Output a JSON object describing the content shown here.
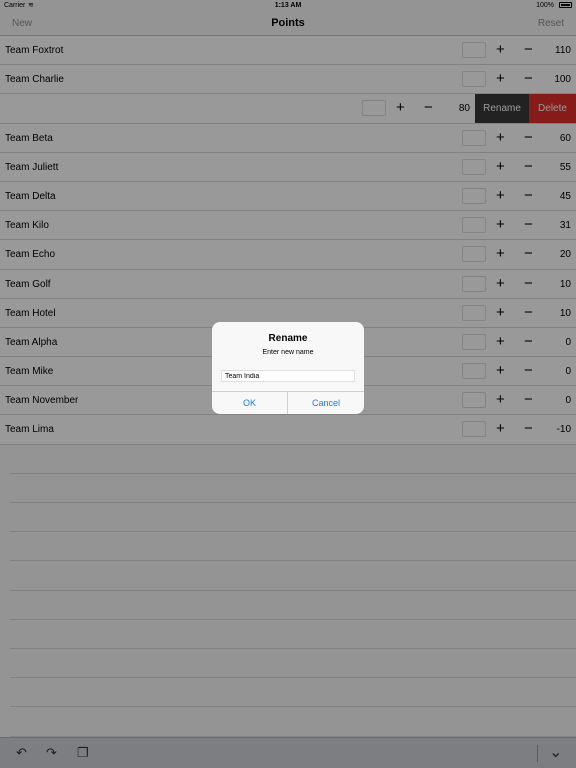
{
  "status_bar": {
    "carrier": "Carrier",
    "wifi_icon": "wifi-icon",
    "time": "1:13 AM",
    "battery": "100%"
  },
  "nav": {
    "left": "New",
    "title": "Points",
    "right": "Reset"
  },
  "rows": [
    {
      "name": "Team Foxtrot",
      "score": "110"
    },
    {
      "name": "Team Charlie",
      "score": "100"
    },
    {
      "name": "",
      "score": "80",
      "swiped": true
    },
    {
      "name": "Team Beta",
      "score": "60"
    },
    {
      "name": "Team Juliett",
      "score": "55"
    },
    {
      "name": "Team Delta",
      "score": "45"
    },
    {
      "name": "Team Kilo",
      "score": "31"
    },
    {
      "name": "Team Echo",
      "score": "20"
    },
    {
      "name": "Team Golf",
      "score": "10"
    },
    {
      "name": "Team Hotel",
      "score": "10"
    },
    {
      "name": "Team Alpha",
      "score": "0"
    },
    {
      "name": "Team Mike",
      "score": "0"
    },
    {
      "name": "Team November",
      "score": "0"
    },
    {
      "name": "Team Lima",
      "score": "-10"
    }
  ],
  "row_controls": {
    "plus": "+",
    "minus": "−"
  },
  "swipe_actions": {
    "rename": "Rename",
    "delete": "Delete"
  },
  "alert": {
    "title": "Rename",
    "message": "Enter new name",
    "input_value": "Team India",
    "ok": "OK",
    "cancel": "Cancel"
  },
  "toolbar": {
    "icons": [
      "undo-icon",
      "redo-icon",
      "paste-icon",
      "chevron-down-icon"
    ],
    "undo": "↶",
    "redo": "↷",
    "paste": "❐",
    "chevron": "⌄"
  },
  "colors": {
    "delete": "#e0302c",
    "rename": "#3a3a3a",
    "link": "#1a7ae8"
  }
}
